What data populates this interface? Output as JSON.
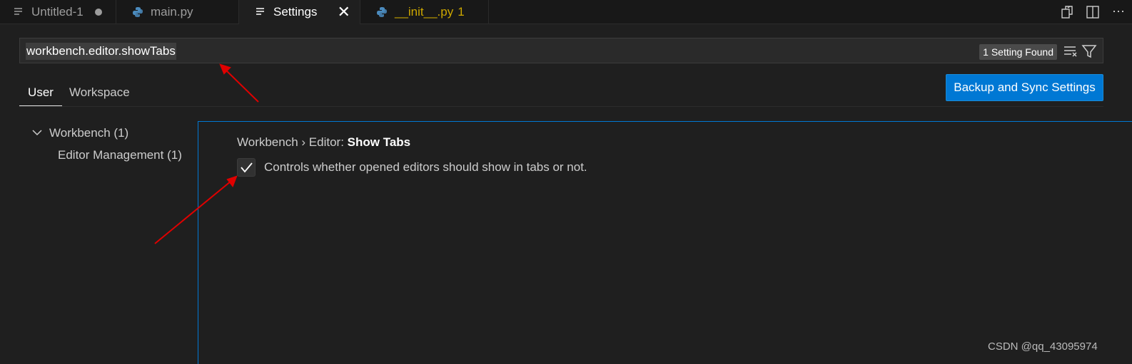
{
  "tabs": [
    {
      "label": "Untitled-1",
      "icon": "file-lines-icon",
      "modified": true
    },
    {
      "label": "main.py",
      "icon": "python-icon"
    },
    {
      "label": "Settings",
      "icon": "file-lines-icon",
      "active": true
    },
    {
      "label": "__init__.py",
      "badge": "1",
      "icon": "python-icon"
    }
  ],
  "search": {
    "value": "workbench.editor.showTabs",
    "result_badge": "1 Setting Found"
  },
  "scope_tabs": {
    "user": "User",
    "workspace": "Workspace"
  },
  "sync_button": "Backup and Sync Settings",
  "toc": {
    "group": "Workbench (1)",
    "subgroup": "Editor Management (1)"
  },
  "setting": {
    "category": "Workbench › Editor: ",
    "name": "Show Tabs",
    "description": "Controls whether opened editors should show in tabs or not.",
    "checked": true
  },
  "watermark": "CSDN @qq_43095974",
  "colors": {
    "accent": "#0078d4",
    "annotation_arrow": "#e00000",
    "warning": "#cca700"
  }
}
